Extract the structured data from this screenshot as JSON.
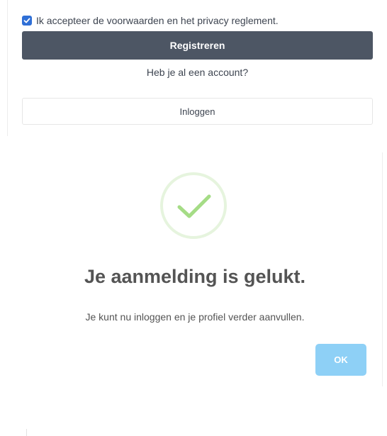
{
  "registration": {
    "terms_label": "Ik accepteer de voorwaarden en het privacy reglement.",
    "terms_checked": true,
    "register_label": "Registreren",
    "account_question": "Heb je al een account?",
    "login_label": "Inloggen"
  },
  "modal": {
    "icon": "checkmark-success-icon",
    "title": "Je aanmelding is gelukt.",
    "message": "Je kunt nu inloggen en je profiel verder aanvullen.",
    "ok_label": "OK"
  },
  "colors": {
    "checkbox": "#2f6fd6",
    "primary_button": "#4d5664",
    "success_green": "#a5dc86",
    "ok_button": "#8ed0f6"
  }
}
